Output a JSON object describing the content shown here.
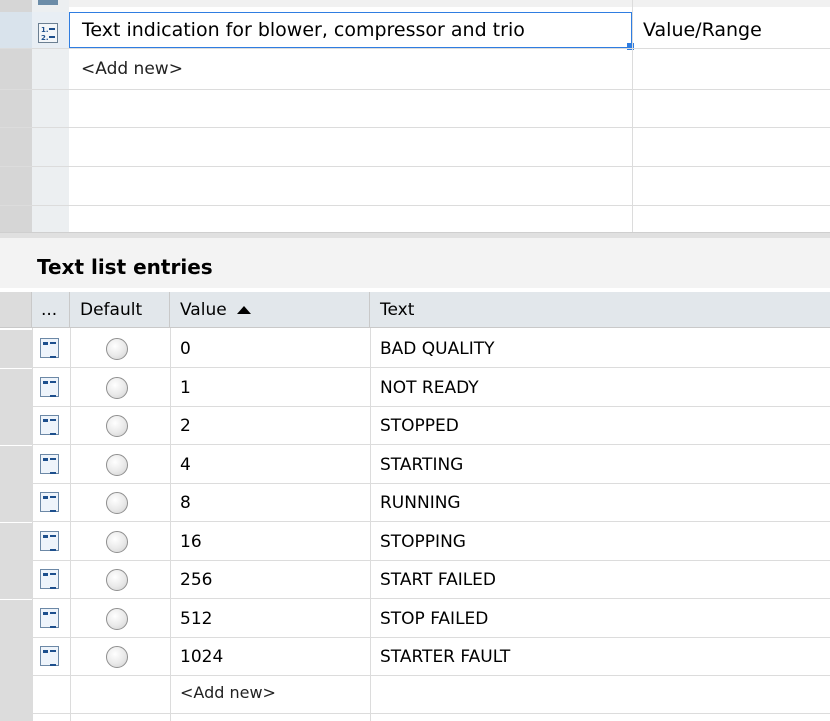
{
  "text_lists": {
    "selected_name": "Text indication for blower, compressor and trio",
    "selected_type": "Value/Range",
    "add_new": "<Add new>"
  },
  "entries": {
    "section_title": "Text list entries",
    "columns": {
      "more": "...",
      "default": "Default",
      "value": "Value",
      "text": "Text"
    },
    "rows": [
      {
        "value": "0",
        "text": "BAD QUALITY"
      },
      {
        "value": "1",
        "text": "NOT READY"
      },
      {
        "value": "2",
        "text": "STOPPED"
      },
      {
        "value": "4",
        "text": "STARTING"
      },
      {
        "value": "8",
        "text": "RUNNING"
      },
      {
        "value": "16",
        "text": "STOPPING"
      },
      {
        "value": "256",
        "text": "START FAILED"
      },
      {
        "value": "512",
        "text": "STOP FAILED"
      },
      {
        "value": "1024",
        "text": "STARTER FAULT"
      }
    ],
    "add_new": "<Add new>"
  },
  "icons": {
    "list_icon": "text-list-icon",
    "entry_icon": "text-entry-icon",
    "default_radio": "radio-button-icon",
    "sort": "sort-ascending-icon"
  },
  "colors": {
    "selection_border": "#2f7de1",
    "gutter": "#d6d6d6",
    "header_bg": "#e2e7eb"
  }
}
